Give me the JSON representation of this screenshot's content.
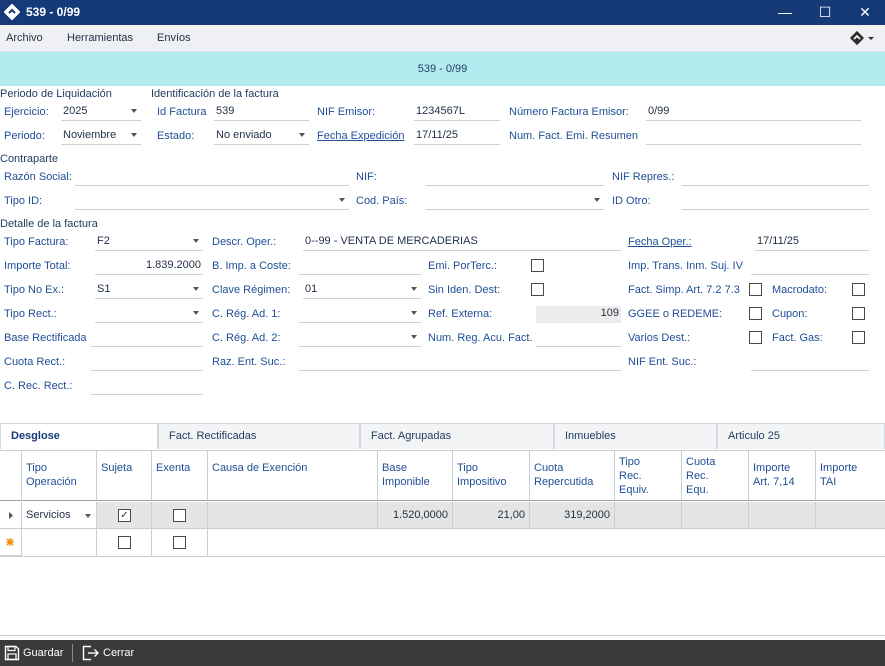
{
  "window": {
    "title": "539 - 0/99",
    "minimize": "—",
    "maximize": "☐",
    "close": "✕"
  },
  "menu": {
    "archivo": "Archivo",
    "herramientas": "Herramientas",
    "envios": "Envíos"
  },
  "banner": "539 - 0/99",
  "periodo": {
    "section": "Periodo de Liquidación",
    "ejercicio_label": "Ejercicio:",
    "ejercicio_value": "2025",
    "periodo_label": "Periodo:",
    "periodo_value": "Noviembre"
  },
  "identificacion": {
    "section": "Identificación de la factura",
    "id_factura_label": "Id Factura",
    "id_factura_value": "539",
    "estado_label": "Estado:",
    "estado_value": "No enviado",
    "nif_emisor_label": "NIF Emisor:",
    "nif_emisor_value": "1234567L",
    "fecha_exp_label": "Fecha Expedición",
    "fecha_exp_value": "17/11/25",
    "num_factura_label": "Número Factura Emisor:",
    "num_factura_value": "0/99",
    "num_resumen_label": "Num. Fact. Emi. Resumen",
    "num_resumen_value": ""
  },
  "contraparte": {
    "section": "Contraparte",
    "razon_social_label": "Razón Social:",
    "razon_social_value": "",
    "nif_label": "NIF:",
    "nif_value": "",
    "nif_repres_label": "NIF Repres.:",
    "nif_repres_value": "",
    "tipo_id_label": "Tipo ID:",
    "tipo_id_value": "",
    "cod_pais_label": "Cod. País:",
    "cod_pais_value": "",
    "id_otro_label": "ID Otro:",
    "id_otro_value": ""
  },
  "detalle": {
    "section": "Detalle de la factura",
    "tipo_factura_label": "Tipo Factura:",
    "tipo_factura_value": "F2",
    "descr_oper_label": "Descr. Oper.:",
    "descr_oper_value": "0--99 - VENTA DE MERCADERIAS",
    "fecha_oper_label": "Fecha Oper.:",
    "fecha_oper_value": "17/11/25",
    "importe_total_label": "Importe Total:",
    "importe_total_value": "1.839.2000",
    "b_imp_coste_label": "B. Imp. a Coste:",
    "b_imp_coste_value": "",
    "emi_porterc_label": "Emi. PorTerc.:",
    "imp_trans_label": "Imp. Trans. Inm. Suj. IV",
    "imp_trans_value": "",
    "tipo_no_ex_label": "Tipo No Ex.:",
    "tipo_no_ex_value": "S1",
    "clave_regimen_label": "Clave Régimen:",
    "clave_regimen_value": "01",
    "sin_iden_label": "Sin Iden. Dest:",
    "fact_simp_label": "Fact. Simp. Art. 7.2 7.3",
    "macrodato_label": "Macrodato:",
    "tipo_rect_label": "Tipo Rect.:",
    "tipo_rect_value": "",
    "c_reg_ad1_label": "C. Rég. Ad. 1:",
    "c_reg_ad1_value": "",
    "ref_externa_label": "Ref. Externa:",
    "ref_externa_value": "109",
    "ggee_label": "GGEE o REDEME:",
    "cupon_label": "Cupon:",
    "base_rect_label": "Base Rectificada",
    "base_rect_value": "",
    "c_reg_ad2_label": "C. Rég. Ad. 2:",
    "c_reg_ad2_value": "",
    "num_reg_acu_label": "Num. Reg. Acu. Fact.",
    "num_reg_acu_value": "",
    "varios_dest_label": "Varios Dest.:",
    "fact_gas_label": "Fact. Gas:",
    "cuota_rect_label": "Cuota Rect.:",
    "cuota_rect_value": "",
    "raz_ent_suc_label": "Raz. Ent. Suc.:",
    "raz_ent_suc_value": "",
    "nif_ent_suc_label": "NIF Ent. Suc.:",
    "nif_ent_suc_value": "",
    "c_rec_rect_label": "C. Rec. Rect.:",
    "c_rec_rect_value": ""
  },
  "tabs": [
    "Desglose",
    "Fact. Rectificadas",
    "Fact. Agrupadas",
    "Inmuebles",
    "Articulo 25"
  ],
  "grid": {
    "headers": {
      "tipo_operacion": "Tipo\nOperación",
      "sujeta": "Sujeta",
      "exenta": "Exenta",
      "causa": "Causa de Exención",
      "base": "Base\nImponible",
      "tipo_imp": "Tipo\nImpositivo",
      "cuota_rep": "Cuota\nRepercutida",
      "tipo_rec": "Tipo\nRec.\nEquiv.",
      "cuota_rec": "Cuota\nRec.\nEqu.",
      "importe_714": "Importe\nArt. 7,14",
      "importe_tai": "Importe\nTAI"
    },
    "row": {
      "tipo_operacion": "Servicios",
      "sujeta_checked": true,
      "exenta_checked": false,
      "base": "1.520,0000",
      "tipo_imp": "21,00",
      "cuota_rep": "319,2000"
    }
  },
  "bottom": {
    "guardar": "Guardar",
    "cerrar": "Cerrar"
  }
}
